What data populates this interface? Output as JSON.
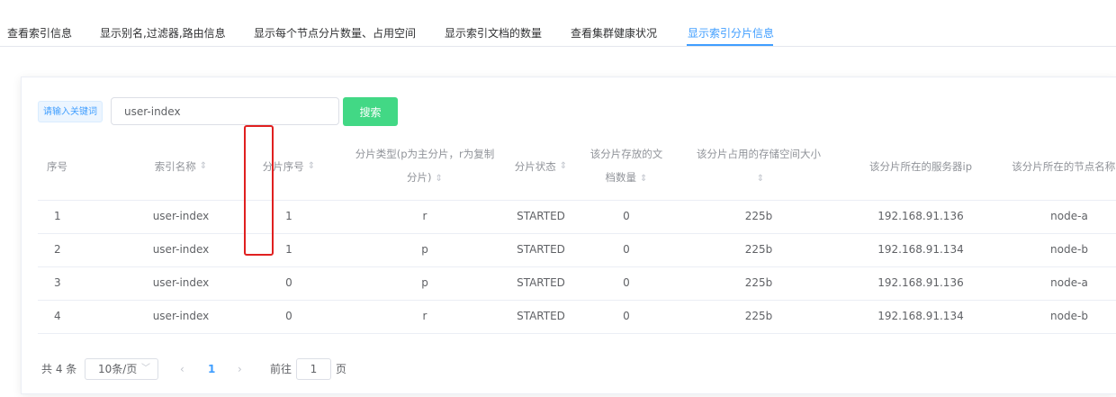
{
  "tabs": [
    {
      "label": "查看索引信息"
    },
    {
      "label": "显示别名,过滤器,路由信息"
    },
    {
      "label": "显示每个节点分片数量、占用空间"
    },
    {
      "label": "显示索引文档的数量"
    },
    {
      "label": "查看集群健康状况"
    },
    {
      "label": "显示索引分片信息"
    }
  ],
  "active_tab": "显示索引分片信息",
  "search": {
    "label": "请输入关键词",
    "value": "user-index",
    "button_label": "搜索"
  },
  "table": {
    "sort_icon": "sort-caret-icon",
    "columns": [
      {
        "label": "序号",
        "sortable": false
      },
      {
        "label": "索引名称",
        "sortable": true
      },
      {
        "label": "分片序号",
        "sortable": true
      },
      {
        "label": "分片类型(p为主分片，r为复制分片)",
        "sortable": true
      },
      {
        "label": "分片状态",
        "sortable": true
      },
      {
        "label": "该分片存放的文档数量",
        "sortable": true
      },
      {
        "label": "该分片占用的存储空间大小",
        "sortable": true
      },
      {
        "label": "该分片所在的服务器ip",
        "sortable": false
      },
      {
        "label": "该分片所在的节点名称",
        "sortable": true
      }
    ],
    "rows": [
      [
        "1",
        "user-index",
        "1",
        "r",
        "STARTED",
        "0",
        "225b",
        "192.168.91.136",
        "node-a"
      ],
      [
        "2",
        "user-index",
        "1",
        "p",
        "STARTED",
        "0",
        "225b",
        "192.168.91.134",
        "node-b"
      ],
      [
        "3",
        "user-index",
        "0",
        "p",
        "STARTED",
        "0",
        "225b",
        "192.168.91.136",
        "node-a"
      ],
      [
        "4",
        "user-index",
        "0",
        "r",
        "STARTED",
        "0",
        "225b",
        "192.168.91.134",
        "node-b"
      ]
    ]
  },
  "pagination": {
    "total_text": "共 4 条",
    "page_size": "10条/页",
    "current_page": "1",
    "goto_label": "前往",
    "goto_value": "1",
    "page_suffix": "页"
  },
  "colors": {
    "accent": "#409eff",
    "search_button": "#42d885",
    "highlight_border": "#e02020"
  }
}
